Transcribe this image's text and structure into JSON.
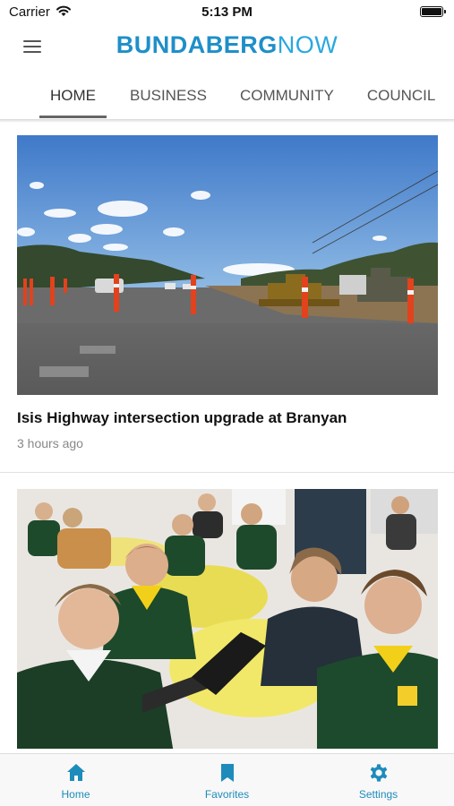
{
  "status_bar": {
    "carrier": "Carrier",
    "time": "5:13 PM",
    "wifi_icon": "wifi-icon",
    "battery_icon": "battery-icon"
  },
  "header": {
    "menu_icon": "hamburger-menu-icon",
    "logo_bold": "BUNDABERG",
    "logo_light": "NOW",
    "brand_color": "#1f8fc8",
    "brand_light_color": "#2aa8df"
  },
  "tabs": [
    {
      "label": "HOME",
      "active": true
    },
    {
      "label": "BUSINESS",
      "active": false
    },
    {
      "label": "COMMUNITY",
      "active": false
    },
    {
      "label": "COUNCIL",
      "active": false
    }
  ],
  "feed": {
    "articles": [
      {
        "title": "Isis Highway intersection upgrade at Branyan",
        "time": "3 hours ago",
        "image": "roadworks-photo"
      },
      {
        "title": "",
        "time": "",
        "image": "students-classroom-photo"
      }
    ]
  },
  "tab_bar": {
    "accent_color": "#1d8cbb",
    "items": [
      {
        "label": "Home",
        "icon": "home-icon"
      },
      {
        "label": "Favorites",
        "icon": "bookmark-icon"
      },
      {
        "label": "Settings",
        "icon": "gear-icon"
      }
    ]
  }
}
